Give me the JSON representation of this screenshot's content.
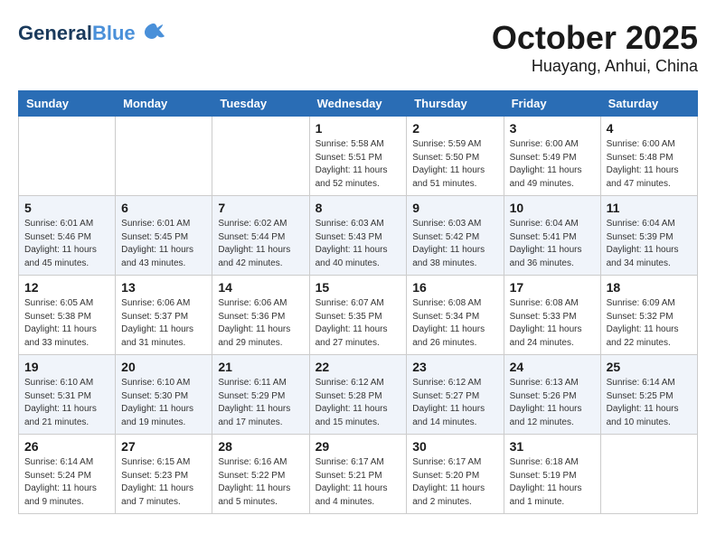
{
  "header": {
    "logo_line1": "General",
    "logo_line2": "Blue",
    "month": "October 2025",
    "location": "Huayang, Anhui, China"
  },
  "weekdays": [
    "Sunday",
    "Monday",
    "Tuesday",
    "Wednesday",
    "Thursday",
    "Friday",
    "Saturday"
  ],
  "weeks": [
    [
      {
        "day": "",
        "info": ""
      },
      {
        "day": "",
        "info": ""
      },
      {
        "day": "",
        "info": ""
      },
      {
        "day": "1",
        "info": "Sunrise: 5:58 AM\nSunset: 5:51 PM\nDaylight: 11 hours and 52 minutes."
      },
      {
        "day": "2",
        "info": "Sunrise: 5:59 AM\nSunset: 5:50 PM\nDaylight: 11 hours and 51 minutes."
      },
      {
        "day": "3",
        "info": "Sunrise: 6:00 AM\nSunset: 5:49 PM\nDaylight: 11 hours and 49 minutes."
      },
      {
        "day": "4",
        "info": "Sunrise: 6:00 AM\nSunset: 5:48 PM\nDaylight: 11 hours and 47 minutes."
      }
    ],
    [
      {
        "day": "5",
        "info": "Sunrise: 6:01 AM\nSunset: 5:46 PM\nDaylight: 11 hours and 45 minutes."
      },
      {
        "day": "6",
        "info": "Sunrise: 6:01 AM\nSunset: 5:45 PM\nDaylight: 11 hours and 43 minutes."
      },
      {
        "day": "7",
        "info": "Sunrise: 6:02 AM\nSunset: 5:44 PM\nDaylight: 11 hours and 42 minutes."
      },
      {
        "day": "8",
        "info": "Sunrise: 6:03 AM\nSunset: 5:43 PM\nDaylight: 11 hours and 40 minutes."
      },
      {
        "day": "9",
        "info": "Sunrise: 6:03 AM\nSunset: 5:42 PM\nDaylight: 11 hours and 38 minutes."
      },
      {
        "day": "10",
        "info": "Sunrise: 6:04 AM\nSunset: 5:41 PM\nDaylight: 11 hours and 36 minutes."
      },
      {
        "day": "11",
        "info": "Sunrise: 6:04 AM\nSunset: 5:39 PM\nDaylight: 11 hours and 34 minutes."
      }
    ],
    [
      {
        "day": "12",
        "info": "Sunrise: 6:05 AM\nSunset: 5:38 PM\nDaylight: 11 hours and 33 minutes."
      },
      {
        "day": "13",
        "info": "Sunrise: 6:06 AM\nSunset: 5:37 PM\nDaylight: 11 hours and 31 minutes."
      },
      {
        "day": "14",
        "info": "Sunrise: 6:06 AM\nSunset: 5:36 PM\nDaylight: 11 hours and 29 minutes."
      },
      {
        "day": "15",
        "info": "Sunrise: 6:07 AM\nSunset: 5:35 PM\nDaylight: 11 hours and 27 minutes."
      },
      {
        "day": "16",
        "info": "Sunrise: 6:08 AM\nSunset: 5:34 PM\nDaylight: 11 hours and 26 minutes."
      },
      {
        "day": "17",
        "info": "Sunrise: 6:08 AM\nSunset: 5:33 PM\nDaylight: 11 hours and 24 minutes."
      },
      {
        "day": "18",
        "info": "Sunrise: 6:09 AM\nSunset: 5:32 PM\nDaylight: 11 hours and 22 minutes."
      }
    ],
    [
      {
        "day": "19",
        "info": "Sunrise: 6:10 AM\nSunset: 5:31 PM\nDaylight: 11 hours and 21 minutes."
      },
      {
        "day": "20",
        "info": "Sunrise: 6:10 AM\nSunset: 5:30 PM\nDaylight: 11 hours and 19 minutes."
      },
      {
        "day": "21",
        "info": "Sunrise: 6:11 AM\nSunset: 5:29 PM\nDaylight: 11 hours and 17 minutes."
      },
      {
        "day": "22",
        "info": "Sunrise: 6:12 AM\nSunset: 5:28 PM\nDaylight: 11 hours and 15 minutes."
      },
      {
        "day": "23",
        "info": "Sunrise: 6:12 AM\nSunset: 5:27 PM\nDaylight: 11 hours and 14 minutes."
      },
      {
        "day": "24",
        "info": "Sunrise: 6:13 AM\nSunset: 5:26 PM\nDaylight: 11 hours and 12 minutes."
      },
      {
        "day": "25",
        "info": "Sunrise: 6:14 AM\nSunset: 5:25 PM\nDaylight: 11 hours and 10 minutes."
      }
    ],
    [
      {
        "day": "26",
        "info": "Sunrise: 6:14 AM\nSunset: 5:24 PM\nDaylight: 11 hours and 9 minutes."
      },
      {
        "day": "27",
        "info": "Sunrise: 6:15 AM\nSunset: 5:23 PM\nDaylight: 11 hours and 7 minutes."
      },
      {
        "day": "28",
        "info": "Sunrise: 6:16 AM\nSunset: 5:22 PM\nDaylight: 11 hours and 5 minutes."
      },
      {
        "day": "29",
        "info": "Sunrise: 6:17 AM\nSunset: 5:21 PM\nDaylight: 11 hours and 4 minutes."
      },
      {
        "day": "30",
        "info": "Sunrise: 6:17 AM\nSunset: 5:20 PM\nDaylight: 11 hours and 2 minutes."
      },
      {
        "day": "31",
        "info": "Sunrise: 6:18 AM\nSunset: 5:19 PM\nDaylight: 11 hours and 1 minute."
      },
      {
        "day": "",
        "info": ""
      }
    ]
  ]
}
